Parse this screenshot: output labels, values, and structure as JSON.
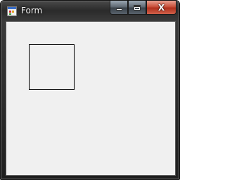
{
  "window": {
    "title": "Form",
    "close_glyph": "X",
    "icons": {
      "app": "form-app-icon",
      "minimize": "minimize-icon",
      "maximize": "maximize-icon",
      "close": "close-icon"
    }
  },
  "colors": {
    "client_background": "#f0f0f0",
    "panel_border": "#000000",
    "close_button": "#c8503a"
  }
}
